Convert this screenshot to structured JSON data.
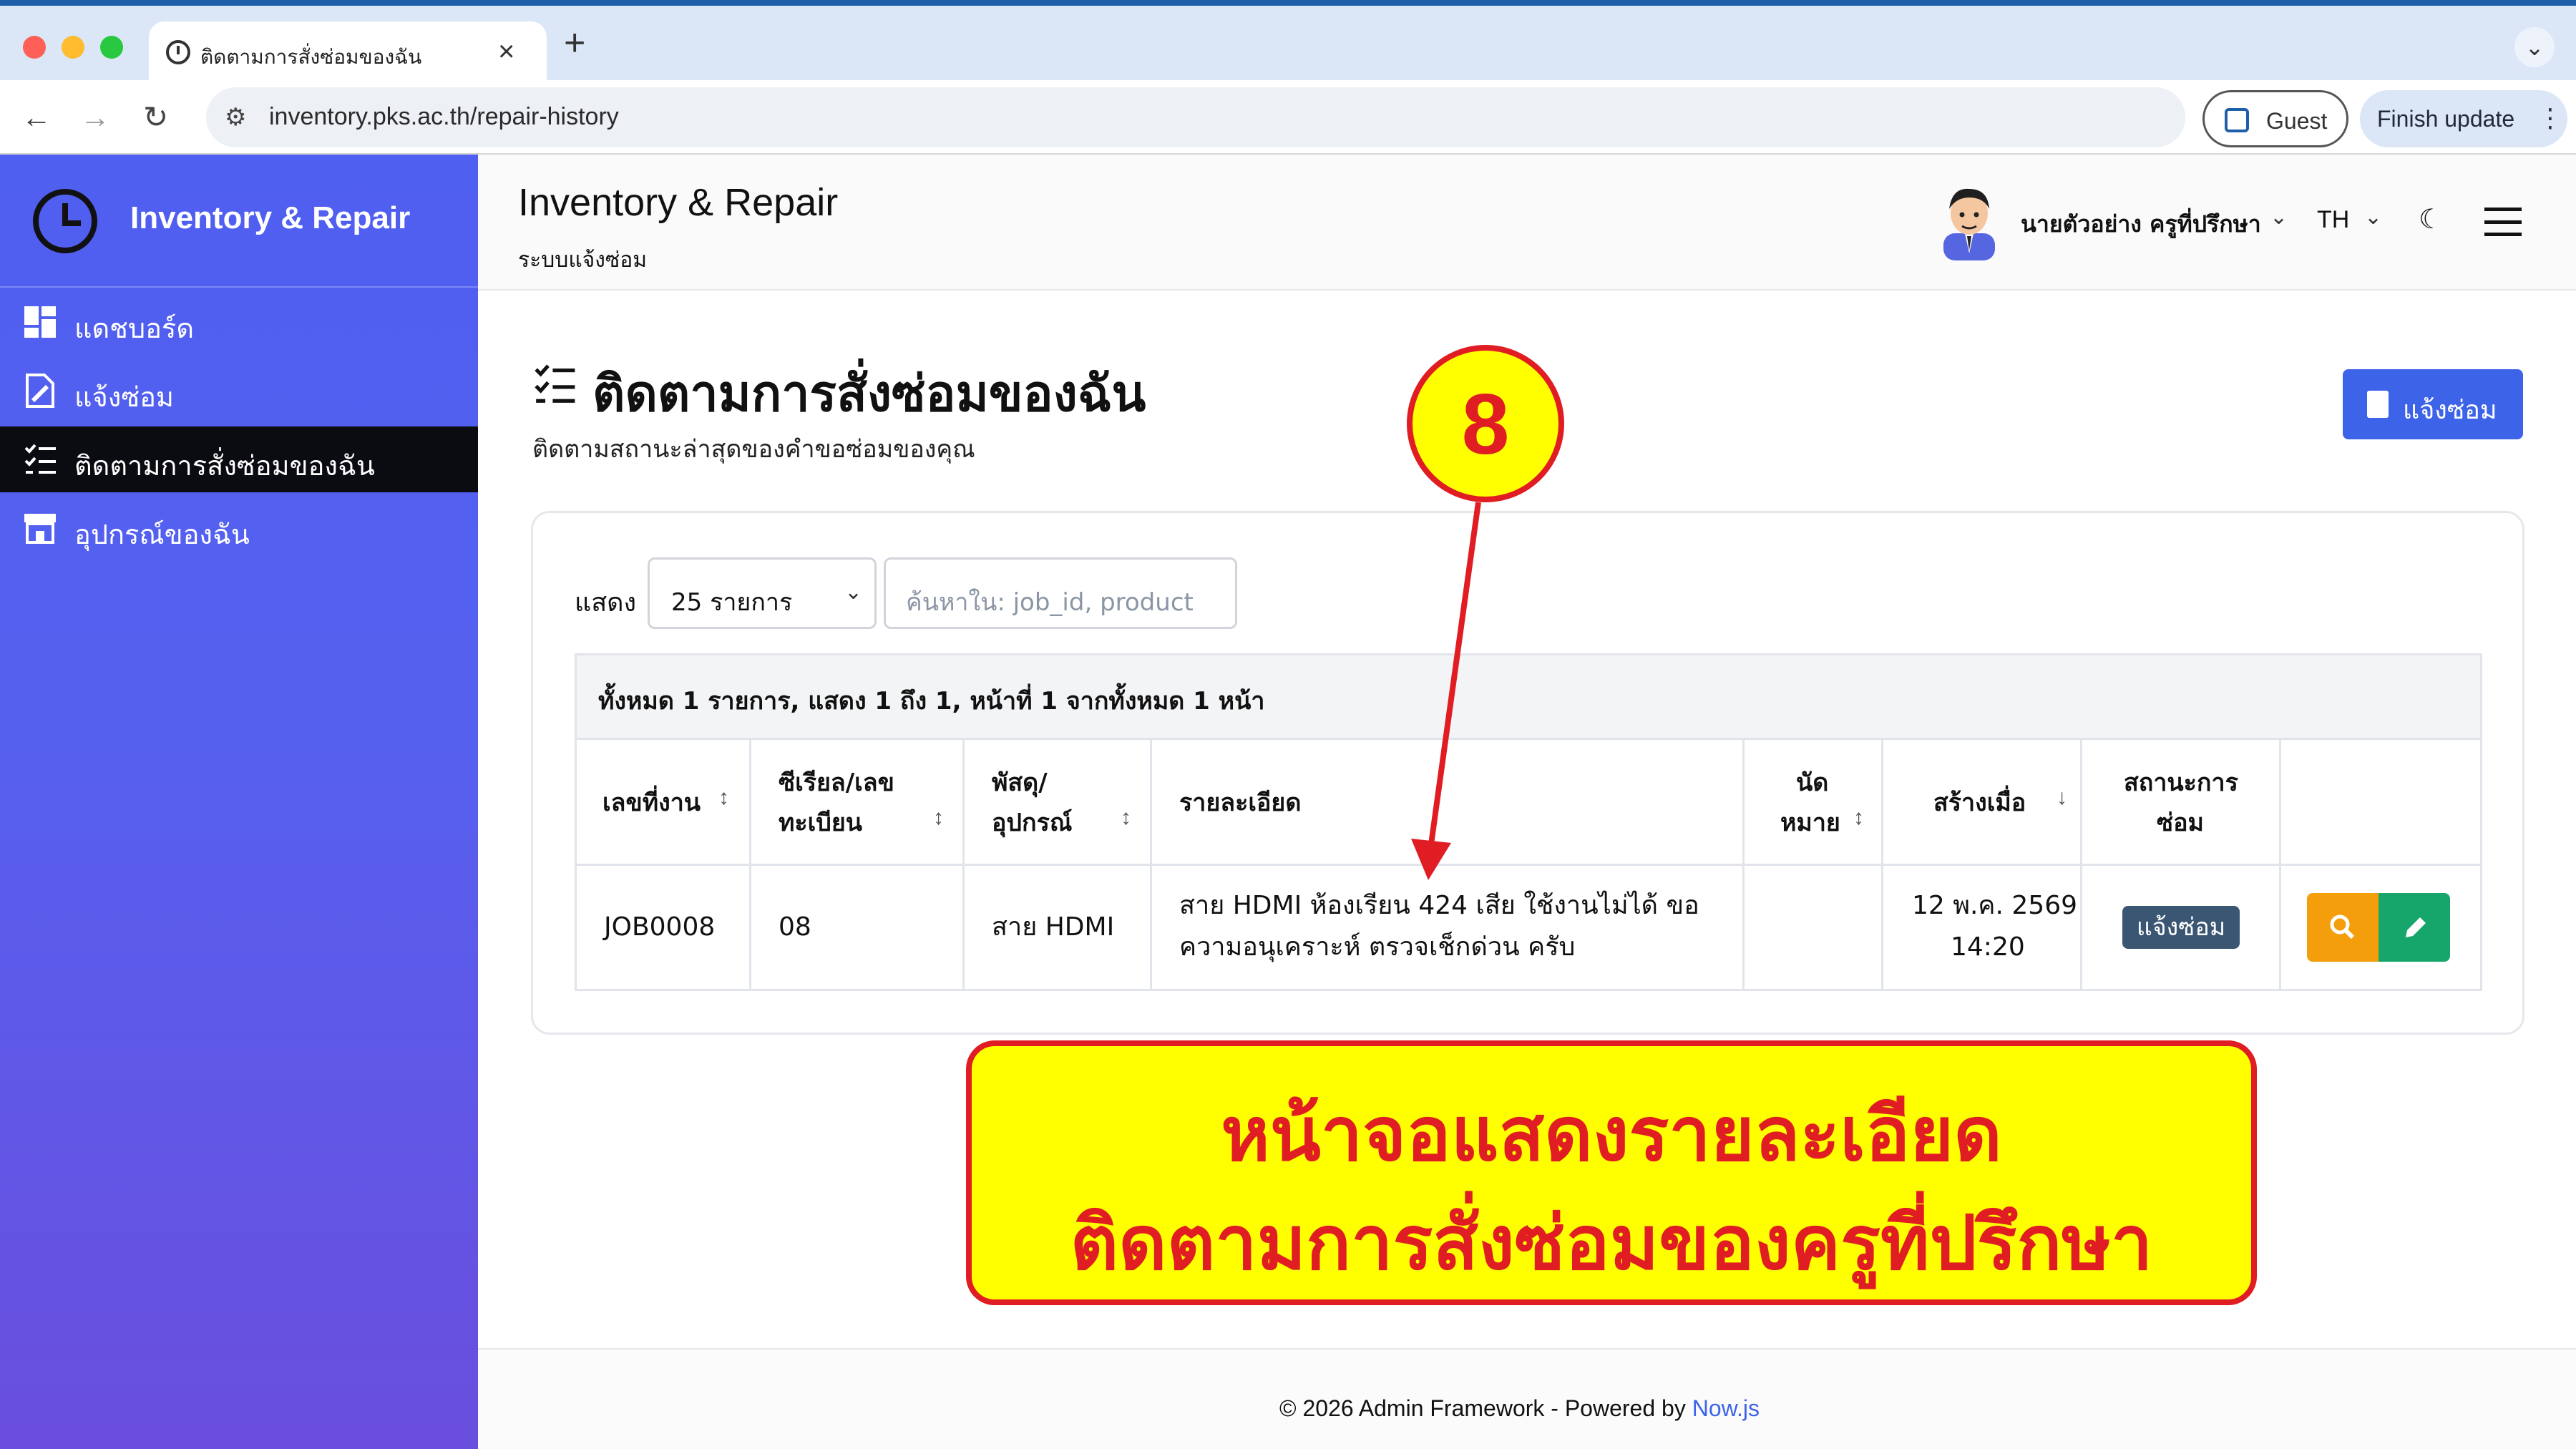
{
  "browser": {
    "tab_title": "ติดตามการสั่งซ่อมของฉัน",
    "tab_close": "×",
    "new_tab": "+",
    "url": "inventory.pks.ac.th/repair-history",
    "guest_label": "Guest",
    "update_label": "Finish update",
    "icons": [
      "back-arrow-icon",
      "forward-arrow-icon",
      "reload-icon",
      "site-info-icon",
      "profile-icon",
      "more-vert-icon"
    ]
  },
  "sidebar": {
    "brand": "Inventory & Repair",
    "items": [
      {
        "label": "แดชบอร์ด",
        "icon": "dashboard-icon",
        "active": false
      },
      {
        "label": "แจ้งซ่อม",
        "icon": "wrench-doc-icon",
        "active": false
      },
      {
        "label": "ติดตามการสั่งซ่อมของฉัน",
        "icon": "checklist-icon",
        "active": true
      },
      {
        "label": "อุปกรณ์ของฉัน",
        "icon": "store-icon",
        "active": false
      }
    ]
  },
  "header": {
    "title": "Inventory & Repair",
    "subtitle": "ระบบแจ้งซ่อม",
    "user_name": "นายตัวอย่าง ครูที่ปรึกษา",
    "language": "TH"
  },
  "page": {
    "title": "ติดตามการสั่งซ่อมของฉัน",
    "subtitle": "ติดตามสถานะล่าสุดของคำขอซ่อมของคุณ",
    "report_button": "แจ้งซ่อม"
  },
  "table": {
    "show_label": "แสดง",
    "per_page": "25 รายการ",
    "search_placeholder": "ค้นหาใน: job_id, product",
    "summary": "ทั้งหมด 1 รายการ, แสดง 1 ถึง 1, หน้าที่ 1 จากทั้งหมด 1 หน้า",
    "columns": [
      {
        "line1": "เลขที่งาน",
        "line2": ""
      },
      {
        "line1": "ซีเรียล/เลข",
        "line2": "ทะเบียน"
      },
      {
        "line1": "พัสดุ/",
        "line2": "อุปกรณ์"
      },
      {
        "line1": "รายละเอียด",
        "line2": ""
      },
      {
        "line1": "นัด",
        "line2": "หมาย"
      },
      {
        "line1": "สร้างเมื่อ",
        "line2": ""
      },
      {
        "line1": "สถานะการ",
        "line2": "ซ่อม"
      }
    ],
    "rows": [
      {
        "job_id": "JOB0008",
        "serial": "08",
        "product": "สาย HDMI",
        "detail_line1": "สาย HDMI ห้องเรียน 424 เสีย ใช้งานไม่ได้ ขอ",
        "detail_line2": "ความอนุเคราะห์ ตรวจเช็กด่วน ครับ",
        "appointment": "",
        "created_date": "12 พ.ค. 2569",
        "created_time": "14:20",
        "status": "แจ้งซ่อม"
      }
    ]
  },
  "footer": {
    "text": "© 2026 Admin Framework - Powered by ",
    "link": "Now.js"
  },
  "annotation": {
    "step_number": "8",
    "banner_line1": "หน้าจอแสดงรายละเอียด",
    "banner_line2": "ติดตามการสั่งซ่อมของครูที่ปรึกษา",
    "color_fill": "#ffff00",
    "color_accent": "#e11d24"
  },
  "colors": {
    "primary": "#3d63e9",
    "sidebar_active": "#0b0b12",
    "status_badge": "#3b5673",
    "view_button": "#f59e0b",
    "edit_button": "#16a56b"
  }
}
